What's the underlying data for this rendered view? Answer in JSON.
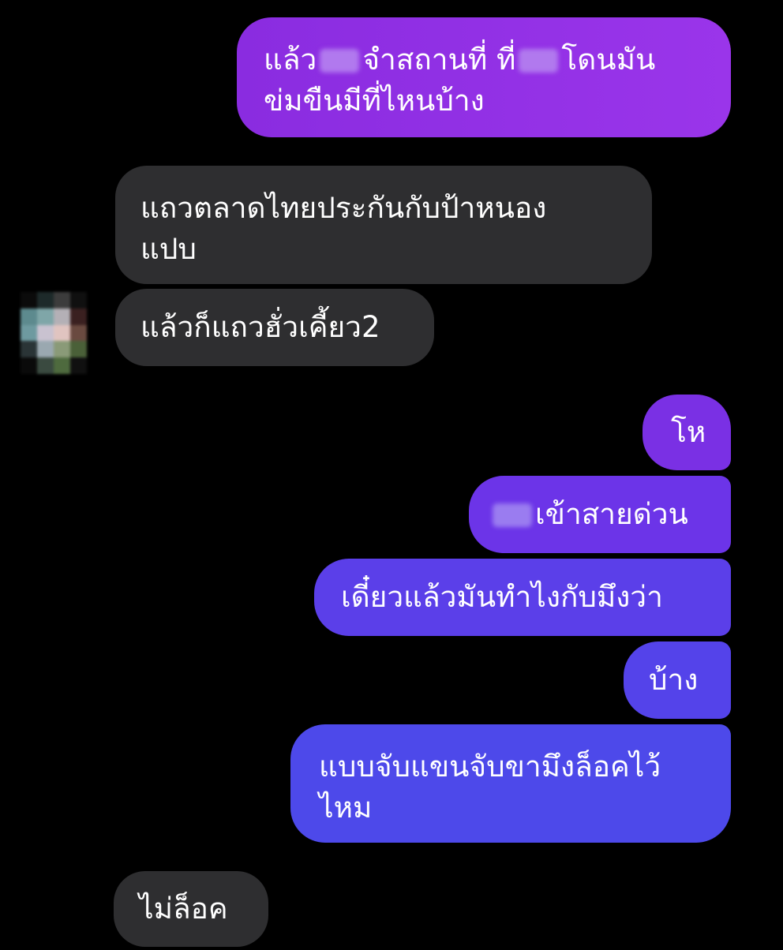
{
  "colors": {
    "background": "#000000",
    "received_bubble": "#2e2e30",
    "sent_top": "#8a2ce0",
    "sent_mid": "#6a36e8",
    "sent_bottom": "#4d49ea",
    "redaction_purple": "#b179ee",
    "redaction_blue": "#8d86f0"
  },
  "avatar": {
    "icon": "pixelated-avatar"
  },
  "messages": [
    {
      "side": "sent",
      "lines": [
        "แล้ว",
        "จำสถานที่ ที่",
        "โดนมัน",
        "ข่มขืนมีที่ไหนบ้าง"
      ]
    },
    {
      "side": "received",
      "lines": [
        "แถวตลาดไทยประกันกับป้าหนอง",
        "แปบ"
      ]
    },
    {
      "side": "received",
      "lines": [
        "แล้วก็แถวฮั่วเคี้ยว2"
      ]
    },
    {
      "side": "sent",
      "lines": [
        "โห"
      ]
    },
    {
      "side": "sent",
      "lines": [
        "เข้าสายด่วน"
      ]
    },
    {
      "side": "sent",
      "lines": [
        "เดี๋ยวแล้วมันทำไงกับมึงว่า"
      ]
    },
    {
      "side": "sent",
      "lines": [
        "บ้าง"
      ]
    },
    {
      "side": "sent",
      "lines": [
        "แบบจับแขนจับขามึงล็อคไว้",
        "ไหม"
      ]
    },
    {
      "side": "received",
      "lines": [
        "ไม่ล็อค"
      ]
    }
  ]
}
